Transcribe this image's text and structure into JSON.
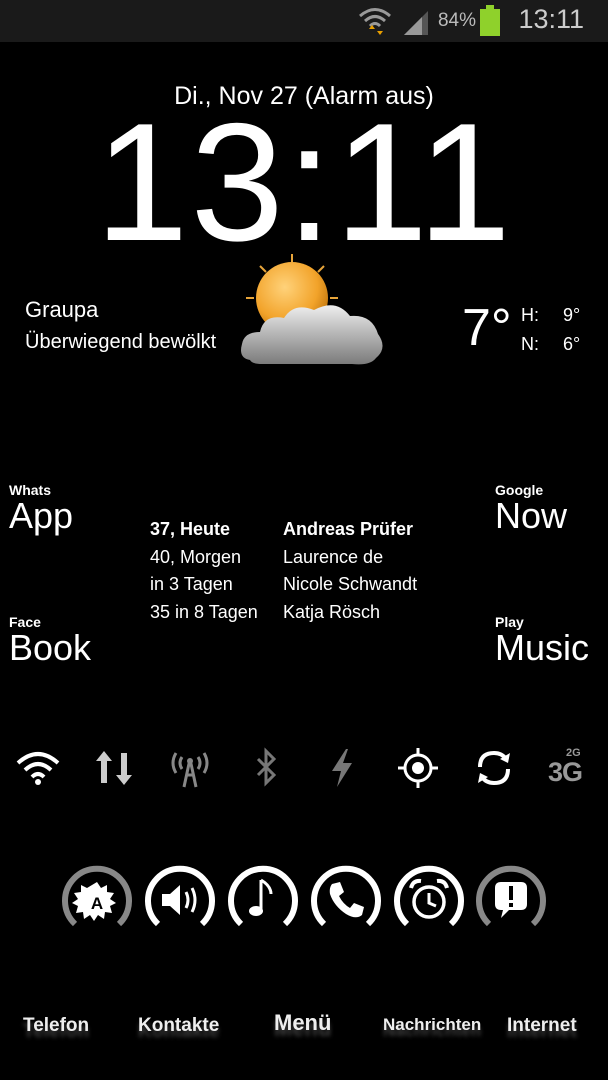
{
  "status_bar": {
    "battery_percent": "84%",
    "time": "13:11",
    "battery_color": "#8fd12b"
  },
  "lockscreen": {
    "date_line": "Di., Nov 27 (Alarm aus)",
    "clock": "13:11"
  },
  "weather": {
    "location": "Graupa",
    "condition": "Überwiegend bewölkt",
    "temp_now": "7°",
    "high_label": "H:",
    "high_value": "9°",
    "low_label": "N:",
    "low_value": "6°",
    "icon": "partly-cloudy-icon"
  },
  "apps": {
    "whatsapp_small": "Whats",
    "whatsapp_big": "App",
    "google_small": "Google",
    "google_big": "Now",
    "facebook_small": "Face",
    "facebook_big": "Book",
    "play_small": "Play",
    "play_big": "Music"
  },
  "events": [
    {
      "when": "37, Heute",
      "who": "Andreas Prüfer"
    },
    {
      "when": "40, Morgen",
      "who": "Laurence de"
    },
    {
      "when": "in 3 Tagen",
      "who": "Nicole Schwandt"
    },
    {
      "when": "35 in 8 Tagen",
      "who": "Katja Rösch"
    }
  ],
  "toggles": [
    "wifi-icon",
    "data-transfer-icon",
    "hotspot-icon",
    "bluetooth-icon",
    "flash-icon",
    "gps-icon",
    "sync-icon",
    "network-3g-icon"
  ],
  "toggle_labels": {
    "net_small": "2G",
    "net_big": "3G"
  },
  "round_buttons": [
    "auto-brightness-icon",
    "volume-icon",
    "music-note-icon",
    "phone-icon",
    "alarm-clock-icon",
    "notification-icon"
  ],
  "round_button_label": "A",
  "dock": {
    "telefon": "Telefon",
    "kontakte": "Kontakte",
    "menu": "Menü",
    "nachrichten": "Nachrichten",
    "internet": "Internet"
  }
}
